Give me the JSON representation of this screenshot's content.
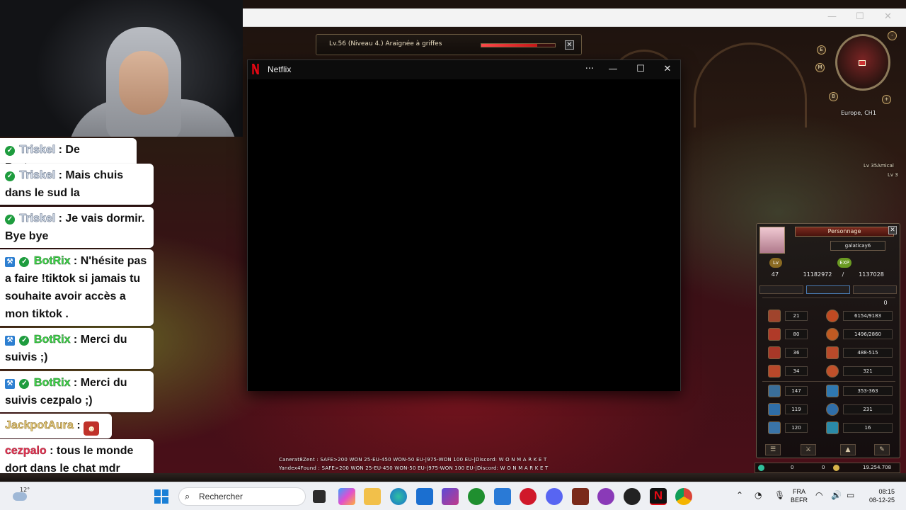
{
  "webcam": {
    "label": ""
  },
  "chat": {
    "messages": [
      {
        "user": "Triskel",
        "text": ": De Bretagne"
      },
      {
        "user": "Triskel",
        "text": ": Mais chuis dans le sud la"
      },
      {
        "user": "Triskel",
        "text": ": Je vais dormir. Bye bye"
      },
      {
        "user": "BotRix",
        "text": ": N'hésite pas a faire !tiktok si jamais tu souhaite avoir accès a mon tiktok ."
      },
      {
        "user": "BotRix",
        "text": ": Merci du suivis ;)"
      },
      {
        "user": "BotRix",
        "text": ": Merci du suivis cezpalo ;)"
      },
      {
        "user": "JackpotAura",
        "text": ":"
      },
      {
        "user": "cezpalo",
        "text": ": tous le monde dort dans le chat mdr"
      }
    ]
  },
  "target": {
    "label": "Lv.56 (Niveau 4.) Araignée à griffes",
    "hp_fraction": 0.76
  },
  "netflix_window": {
    "title": "Netflix",
    "more": "···",
    "minimize": "—",
    "maximize": "☐",
    "close": "✕"
  },
  "minimap": {
    "server": "Europe, CH1",
    "buttons": [
      "E",
      "M",
      "B",
      "+",
      "-"
    ]
  },
  "nearby": {
    "tag1": "Lv 35Amical",
    "tag2": "Lv 3"
  },
  "character": {
    "title": "Personnage",
    "name": "galaticay6",
    "lv_label": "Lv",
    "exp_label": "EXP",
    "level": "47",
    "exp_current": "11182972",
    "exp_sep": "/",
    "exp_max": "1137028",
    "points": "0",
    "stats_left": [
      "21",
      "80",
      "36",
      "34"
    ],
    "stats_right": [
      "6154/9183",
      "1496/2860",
      "488-515",
      "321"
    ],
    "stats2_left": [
      "147",
      "119",
      "120"
    ],
    "stats2_right": [
      "353-363",
      "231",
      "16"
    ]
  },
  "game_messages": [
    "Canerat8Zent : SAFE>200 WON 25-EU-450 WON-50 EU-|975-WON 100 EU-|Discord: W O N M A R K E T",
    "Yandex4Found : SAFE>200 WON 25-EU-450 WON-50 EU-|975-WON 100 EU-|Discord: W O N M A R K E T"
  ],
  "gold": {
    "a": "0",
    "b": "0",
    "c": "19.254.708"
  },
  "taskbar": {
    "weather": "12°",
    "search_placeholder": "Rechercher",
    "lang1": "FRA",
    "lang2": "BEFR",
    "time": "08:15",
    "date": "08-12-25"
  },
  "colors": {
    "netflix_red": "#e50914",
    "chat_bg": "#ffffff",
    "taskbar_bg": "#eef0f4"
  }
}
